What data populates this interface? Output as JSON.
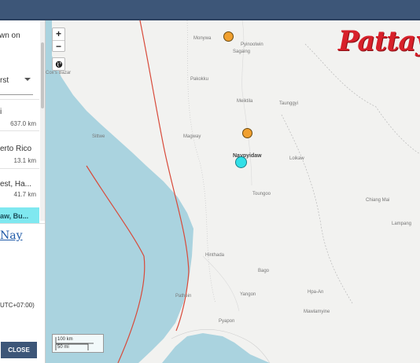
{
  "header": {
    "color": "#3d5678"
  },
  "sidebar": {
    "heading_fragment": "wn on",
    "sort_value": "rst",
    "items": [
      {
        "label": "i",
        "distance": "637.0 km"
      },
      {
        "label": "erto Rico",
        "distance": "13.1 km"
      },
      {
        "label": "est, Ha...",
        "distance": "41.7 km"
      },
      {
        "label": "aw, Bu...",
        "distance": ""
      }
    ],
    "detail": {
      "title": "Nay",
      "timezone": "UTC+07:00)",
      "close_label": "CLOSE"
    }
  },
  "map": {
    "controls": {
      "zoom_in": "+",
      "zoom_out": "−"
    },
    "scale": {
      "top": "100 km",
      "bottom": "50 mi"
    },
    "labels": {
      "monywa": "Monywa",
      "pyinoolwin": "Pyinoolwin",
      "sagaing": "Sagaing",
      "pakokku": "Pakokku",
      "meiktila": "Meiktila",
      "taunggyi": "Taunggyi",
      "sittwe": "Sittwe",
      "magway": "Magway",
      "naypyidaw": "Naypyidaw",
      "loikaw": "Loikaw",
      "toungoo": "Toungoo",
      "chiang_mai": "Chiang Mai",
      "lampang": "Lampang",
      "hinthada": "Hinthada",
      "bago": "Bago",
      "yangon": "Yangon",
      "hpa_an": "Hpa-An",
      "mawlamyine": "Mawlamyine",
      "pathein": "Pathein",
      "pyapon": "Pyapon",
      "cox_bazar": "Cox's Bazar"
    },
    "markers": [
      {
        "name": "quake-north",
        "color": "#f0a030"
      },
      {
        "name": "quake-central",
        "color": "#f0a030"
      },
      {
        "name": "quake-selected",
        "color": "#32e0e8"
      }
    ]
  },
  "watermark": {
    "text": "Pattay",
    "color": "#d8202a"
  }
}
